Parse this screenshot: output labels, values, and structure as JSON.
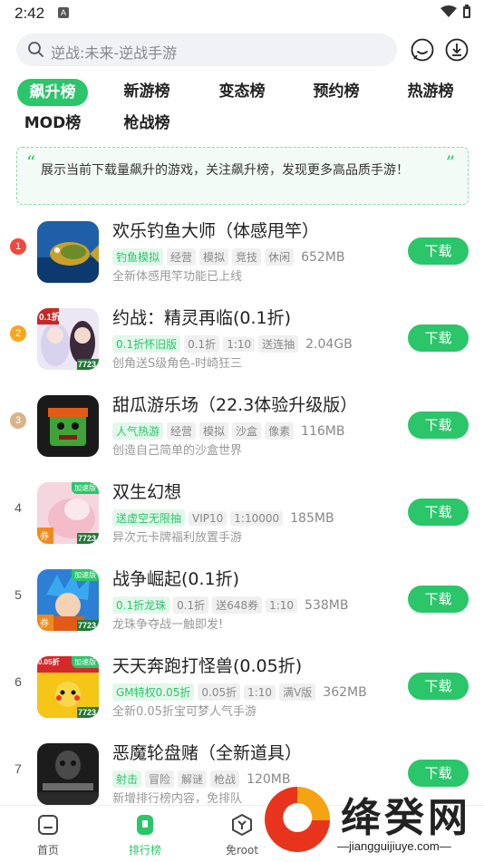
{
  "status": {
    "time": "2:42",
    "a_label": "A"
  },
  "search": {
    "placeholder": "逆战:未来-逆战手游"
  },
  "tabs": [
    {
      "label": "飙升榜",
      "active": true
    },
    {
      "label": "新游榜"
    },
    {
      "label": "变态榜"
    },
    {
      "label": "预约榜"
    },
    {
      "label": "热游榜"
    },
    {
      "label": "MOD榜"
    },
    {
      "label": "枪战榜"
    }
  ],
  "banner": {
    "open_quote": "“",
    "close_quote": "”",
    "text": "展示当前下载量飙升的游戏，关注飙升榜，发现更多高品质手游！"
  },
  "download_label": "下载",
  "games": [
    {
      "rank": "1",
      "title": "欢乐钓鱼大师（体感甩竿）",
      "tags": [
        "钓鱼模拟",
        "经营",
        "模拟",
        "竞技",
        "休闲"
      ],
      "size": "652MB",
      "desc": "全新体感甩竿功能已上线"
    },
    {
      "rank": "2",
      "title": "约战：精灵再临(0.1折)",
      "tags": [
        "0.1折怀旧版",
        "0.1折",
        "1:10",
        "送连抽"
      ],
      "size": "2.04GB",
      "desc": "创角送S级角色-时崎狂三"
    },
    {
      "rank": "3",
      "title": "甜瓜游乐场（22.3体验升级版）",
      "tags": [
        "人气热游",
        "经营",
        "模拟",
        "沙盒",
        "像素"
      ],
      "size": "116MB",
      "desc": "创造自己简单的沙盒世界"
    },
    {
      "rank": "4",
      "title": "双生幻想",
      "tags": [
        "送虚空无限抽",
        "VIP10",
        "1:10000"
      ],
      "size": "185MB",
      "desc": "异次元卡牌福利放置手游"
    },
    {
      "rank": "5",
      "title": "战争崛起(0.1折)",
      "tags": [
        "0.1折龙珠",
        "0.1折",
        "送648券",
        "1:10"
      ],
      "size": "538MB",
      "desc": "龙珠争夺战一触即发!"
    },
    {
      "rank": "6",
      "title": "天天奔跑打怪兽(0.05折)",
      "tags": [
        "GM特权0.05折",
        "0.05折",
        "1:10",
        "满V版"
      ],
      "size": "362MB",
      "desc": "全新0.05折宝可梦人气手游"
    },
    {
      "rank": "7",
      "title": "恶魔轮盘赌（全新道具）",
      "tags": [
        "射击",
        "冒险",
        "解谜",
        "枪战"
      ],
      "size": "120MB",
      "desc": "新增排行榜内容，免排队"
    }
  ],
  "icon_badges": {
    "speed": "加速版",
    "coupon": "券",
    "num": "7723",
    "discount_01": "0.1折",
    "discount_005": "0.05折"
  },
  "bottom_nav": [
    {
      "label": "首页"
    },
    {
      "label": "排行榜",
      "active": true
    },
    {
      "label": "免root"
    }
  ],
  "watermark": {
    "brand": "绛癸网",
    "url": "—jiangguijiuye.com—"
  },
  "colors": {
    "accent": "#2bc56a",
    "rank1": "#f0483e",
    "rank2": "#f5a623",
    "rank3": "#d9b48a"
  }
}
